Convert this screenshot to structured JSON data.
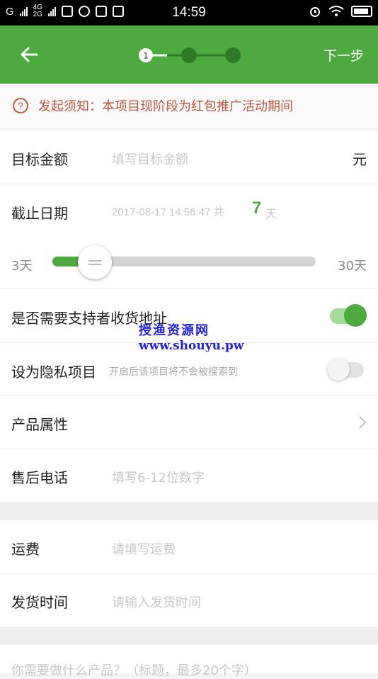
{
  "status_bar": {
    "carrier": "G",
    "network_top": "4G",
    "network_bottom": "2G",
    "time": "14:59"
  },
  "header": {
    "step_current": "1",
    "next_label": "下一步",
    "accent_color": "#4caa3f"
  },
  "notice": {
    "icon": "question-circle-icon",
    "text": "发起须知：本项目现阶段为红包推广活动期间"
  },
  "target_amount": {
    "label": "目标金额",
    "placeholder": "填写目标金额",
    "unit": "元"
  },
  "deadline": {
    "label": "截止日期",
    "date": "2017-08-17 14:56:47 共",
    "days": "7",
    "days_unit": "天"
  },
  "duration_slider": {
    "min_label": "3天",
    "max_label": "30天",
    "value_fraction": 0.15
  },
  "shipping_address": {
    "label": "是否需要支持者收货地址",
    "enabled": true
  },
  "watermark": {
    "line1": "授渔资源网",
    "line2": "www.shouyu.pw"
  },
  "private_project": {
    "label": "设为隐私项目",
    "hint": "开启后该项目将不会被搜索到",
    "enabled": false
  },
  "product_attributes": {
    "label": "产品属性",
    "icon": "chevron-right-icon"
  },
  "after_sales_phone": {
    "label": "售后电话",
    "placeholder": "填写6-12位数字"
  },
  "shipping_fee": {
    "label": "运费",
    "placeholder": "请填写运费"
  },
  "delivery_time": {
    "label": "发货时间",
    "placeholder": "请输入发货时间"
  },
  "bottom_prompt": {
    "text": "你需要做什么产品？（标题，最多20个字）"
  }
}
